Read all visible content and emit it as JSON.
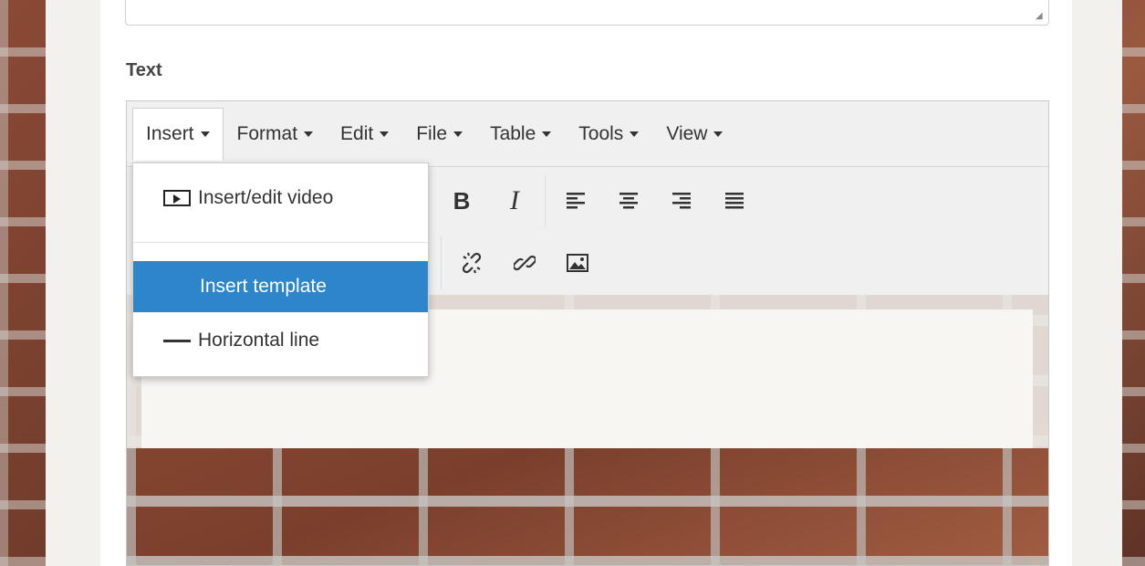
{
  "form": {
    "field_label": "Text"
  },
  "editor": {
    "menubar": [
      {
        "label": "Insert",
        "active": true
      },
      {
        "label": "Format"
      },
      {
        "label": "Edit"
      },
      {
        "label": "File"
      },
      {
        "label": "Table"
      },
      {
        "label": "Tools"
      },
      {
        "label": "View"
      }
    ],
    "toolbar": {
      "bold": "B",
      "italic": "I"
    }
  },
  "insert_menu": {
    "items": [
      {
        "label": "Insert/edit video",
        "icon": "video-icon"
      },
      {
        "label": "Insert template",
        "highlighted": true
      },
      {
        "label": "Horizontal line",
        "icon": "horizontal-line-icon"
      }
    ]
  },
  "colors": {
    "highlight": "#2d86c9",
    "menubar_bg": "#f0f0f0"
  }
}
